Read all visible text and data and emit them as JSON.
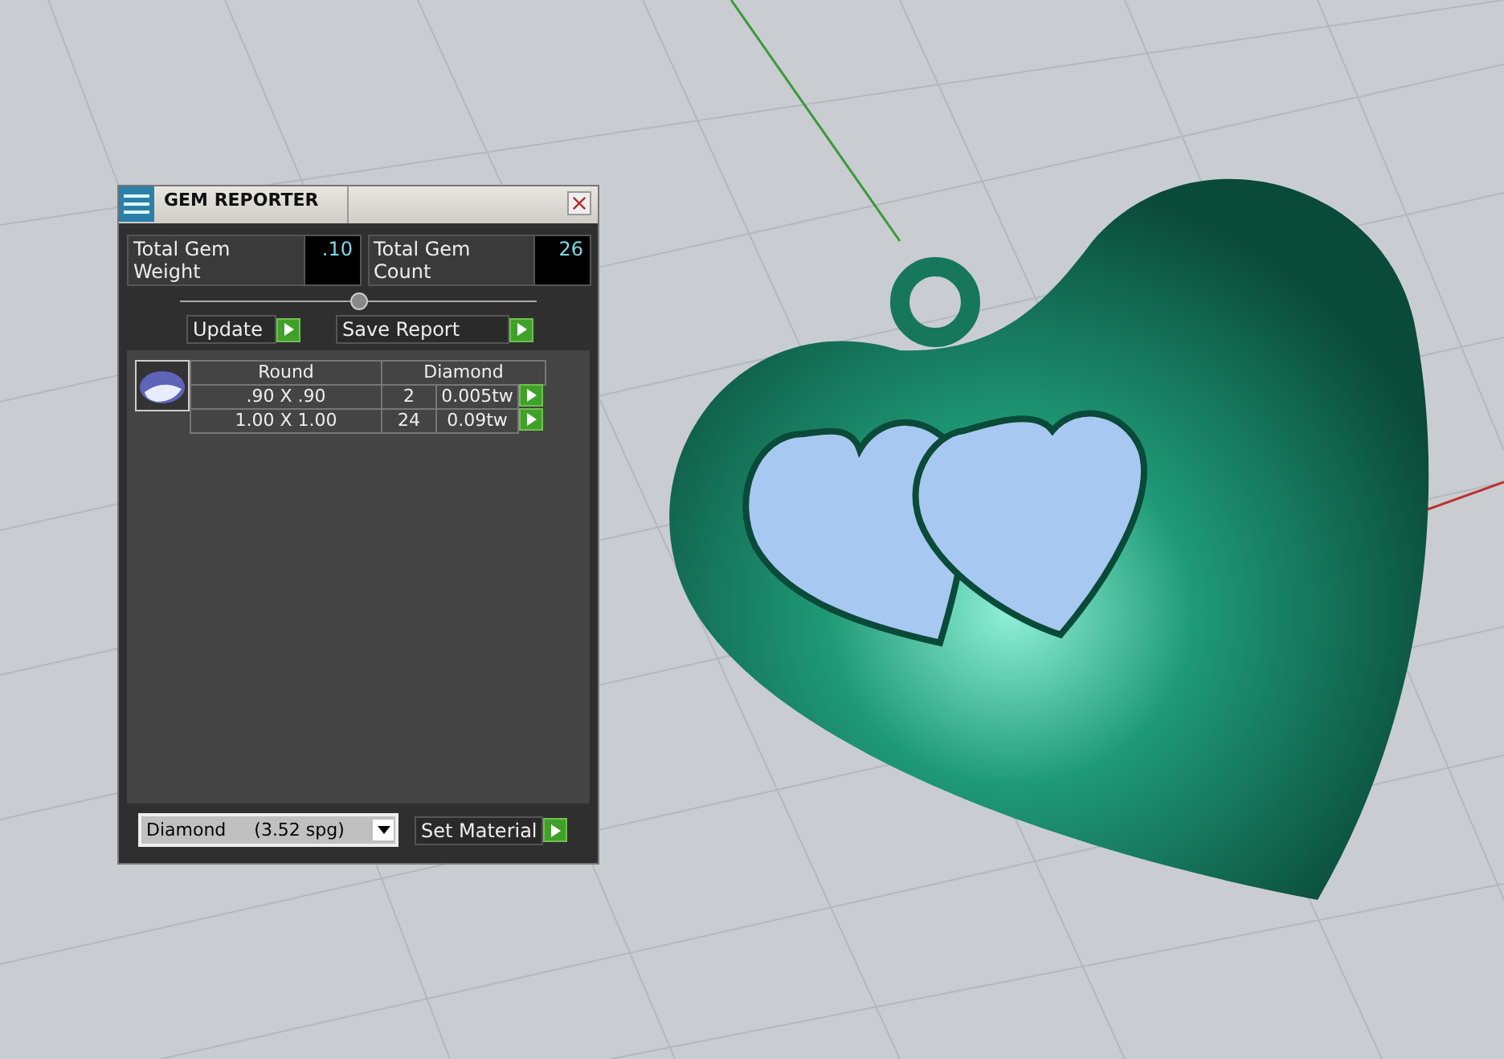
{
  "window": {
    "title": "GEM REPORTER"
  },
  "totals": [
    {
      "label": "Total Gem Weight",
      "value": ".10"
    },
    {
      "label": "Total Gem Count",
      "value": "26"
    }
  ],
  "buttons": [
    {
      "label": "Update"
    },
    {
      "label": "Save Report"
    }
  ],
  "table": {
    "columns": [
      "Round",
      "Diamond"
    ],
    "rows": [
      {
        "size": ".90 X .90",
        "count": "2",
        "weight": "0.005tw"
      },
      {
        "size": "1.00 X 1.00",
        "count": "24",
        "weight": "0.09tw"
      }
    ]
  },
  "material": {
    "value": "Diamond     (3.52 spg)"
  },
  "set_button": {
    "label": "Set Material"
  }
}
